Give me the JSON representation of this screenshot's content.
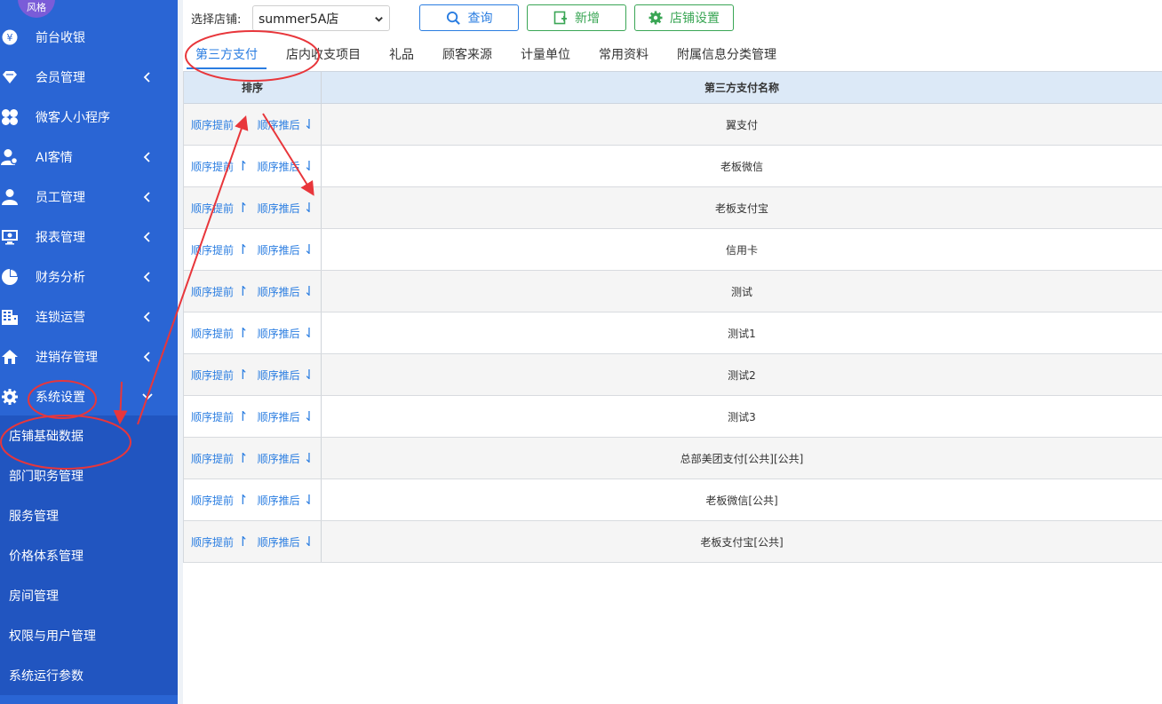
{
  "sidebar": {
    "avatar_text": "风格",
    "items": [
      {
        "label": "前台收银",
        "icon": "yen-icon",
        "has_chevron": false
      },
      {
        "label": "会员管理",
        "icon": "diamond-icon",
        "has_chevron": true
      },
      {
        "label": "微客人小程序",
        "icon": "clover-icon",
        "has_chevron": false
      },
      {
        "label": "AI客情",
        "icon": "user-pin-icon",
        "has_chevron": true
      },
      {
        "label": "员工管理",
        "icon": "user-icon",
        "has_chevron": true
      },
      {
        "label": "报表管理",
        "icon": "monitor-icon",
        "has_chevron": true
      },
      {
        "label": "财务分析",
        "icon": "pie-chart-icon",
        "has_chevron": true
      },
      {
        "label": "连锁运营",
        "icon": "building-icon",
        "has_chevron": true
      },
      {
        "label": "进销存管理",
        "icon": "home-icon",
        "has_chevron": true
      },
      {
        "label": "系统设置",
        "icon": "gear-icon",
        "has_chevron": true,
        "expanded": true
      }
    ],
    "sub_items": [
      {
        "label": "店铺基础数据"
      },
      {
        "label": "部门职务管理"
      },
      {
        "label": "服务管理"
      },
      {
        "label": "价格体系管理"
      },
      {
        "label": "房间管理"
      },
      {
        "label": "权限与用户管理"
      },
      {
        "label": "系统运行参数"
      }
    ]
  },
  "toolbar": {
    "store_label": "选择店铺:",
    "store_value": "summer5A店",
    "query_label": "查询",
    "add_label": "新增",
    "settings_label": "店铺设置"
  },
  "tabs": [
    {
      "label": "第三方支付",
      "active": true
    },
    {
      "label": "店内收支项目"
    },
    {
      "label": "礼品"
    },
    {
      "label": "顾客来源"
    },
    {
      "label": "计量单位"
    },
    {
      "label": "常用资料"
    },
    {
      "label": "附属信息分类管理"
    }
  ],
  "table": {
    "headers": [
      "排序",
      "第三方支付名称"
    ],
    "move_up_label": "顺序提前",
    "move_down_label": "顺序推后",
    "rows": [
      "翼支付",
      "老板微信",
      "老板支付宝",
      "信用卡",
      "测试",
      "测试1",
      "测试2",
      "测试3",
      "总部美团支付[公共][公共]",
      "老板微信[公共]",
      "老板支付宝[公共]"
    ]
  },
  "colors": {
    "sidebar_bg": "#2a65d4",
    "submenu_bg": "#2155c0",
    "accent_blue": "#2a7de1",
    "accent_green": "#3aa655",
    "header_bg": "#dce9f7",
    "annotation_red": "#e8363b"
  }
}
